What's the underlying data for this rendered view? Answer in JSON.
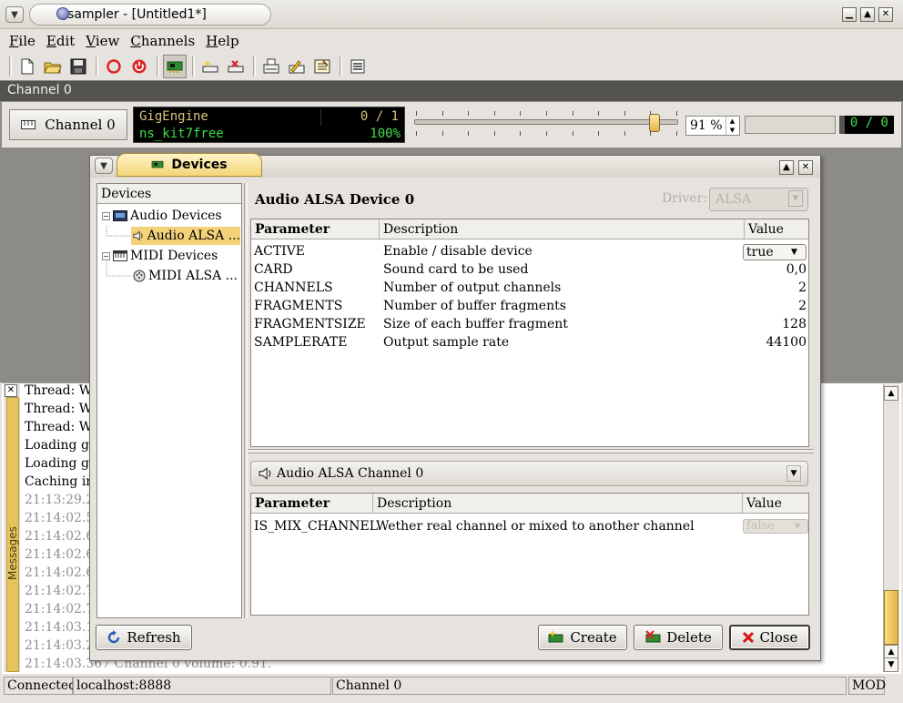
{
  "window": {
    "title": "Qsampler - [Untitled1*]",
    "controls": {
      "minimize": "▁",
      "maximize": "▲",
      "close": "✕"
    }
  },
  "menu": [
    "File",
    "Edit",
    "View",
    "Channels",
    "Help"
  ],
  "menu_mnemonics": [
    "F",
    "E",
    "V",
    "C",
    "H"
  ],
  "channel_strip": {
    "title": "Channel 0",
    "button_label": "Channel 0",
    "engine": "GigEngine",
    "instrument": "ns_kit7free",
    "voices": "0 / 1",
    "load": "100%",
    "volume": "91 %",
    "volume_value": 0.91,
    "stream_count": "0 / 0"
  },
  "messages": {
    "dock_label": "Messages",
    "lines": [
      "Thread: W...",
      "Thread: W...",
      "Thread: W...",
      "Loading gig...",
      "Loading gig...",
      "Caching in...",
      "21:13:29.2...",
      "21:14:02.5...",
      "21:14:02.6...",
      "21:14:02.6...",
      "21:14:02.6...",
      "21:14:02.7...",
      "21:14:02.7...",
      "21:14:03.1...",
      "21:14:03.2...",
      "21:14:03.367 Channel 0 volume: 0.91."
    ],
    "display_lines": [
      "Thread: W.",
      "Thread: W.",
      "Thread: W.",
      "Loading gi;",
      "Loading gi;",
      "Caching in",
      "21:13:29.2",
      "21:14:02.5",
      "21:14:02.6",
      "21:14:02.6",
      "21:14:02.6",
      "21:14:02.7",
      "21:14:02.7",
      "21:14:03.1",
      "21:14:03.2",
      "21:14:03.367 Channel 0 volume: 0.91."
    ]
  },
  "statusbar": {
    "connection": "Connected",
    "server": "localhost:8888",
    "channel": "Channel 0",
    "mode": "MOD"
  },
  "devices_dialog": {
    "title": "Devices",
    "tree_header": "Devices",
    "tree": {
      "audio_group": "Audio Devices",
      "audio_item": "Audio ALSA ...",
      "midi_group": "MIDI Devices",
      "midi_item": "MIDI ALSA ..."
    },
    "device_title": "Audio ALSA Device 0",
    "driver_label": "Driver:",
    "driver_value": "ALSA",
    "param_headers": {
      "parameter": "Parameter",
      "description": "Description",
      "value": "Value"
    },
    "params": [
      {
        "name": "ACTIVE",
        "description": "Enable / disable device",
        "value": "true"
      },
      {
        "name": "CARD",
        "description": "Sound card to be used",
        "value": "0,0"
      },
      {
        "name": "CHANNELS",
        "description": "Number of output channels",
        "value": "2"
      },
      {
        "name": "FRAGMENTS",
        "description": "Number of buffer fragments",
        "value": "2"
      },
      {
        "name": "FRAGMENTSIZE",
        "description": "Size of each buffer fragment",
        "value": "128"
      },
      {
        "name": "SAMPLERATE",
        "description": "Output sample rate",
        "value": "44100"
      }
    ],
    "channel_selector": "Audio ALSA Channel 0",
    "channel_params": [
      {
        "name": "IS_MIX_CHANNEL",
        "description": "Wether real channel or mixed to another channel",
        "value": "false"
      }
    ],
    "buttons": {
      "refresh": "Refresh",
      "create": "Create",
      "delete": "Delete",
      "close": "Close"
    }
  }
}
